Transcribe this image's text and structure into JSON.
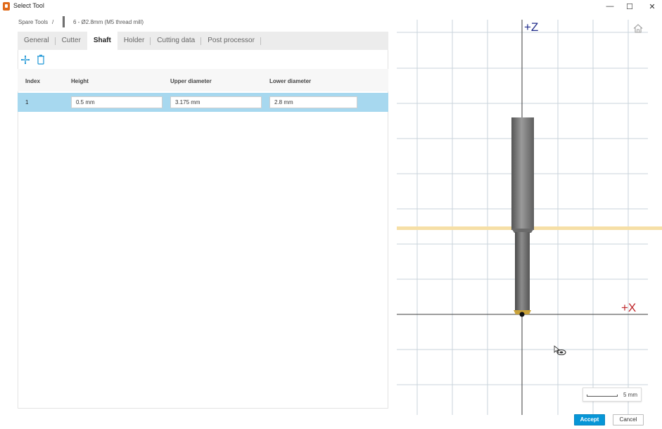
{
  "window": {
    "title": "Select Tool",
    "controls": {
      "minimize": "—",
      "maximize": "☐",
      "close": "✕"
    }
  },
  "breadcrumb": {
    "library": "Spare Tools",
    "separator": "/",
    "tool": "6 - Ø2.8mm (M5 thread mill)"
  },
  "tabs": [
    "General",
    "Cutter",
    "Shaft",
    "Holder",
    "Cutting data",
    "Post processor"
  ],
  "active_tab": "Shaft",
  "toolbar": {
    "add_icon": "plus-icon",
    "delete_icon": "trash-icon"
  },
  "table": {
    "columns": [
      "Index",
      "Height",
      "Upper diameter",
      "Lower diameter"
    ],
    "rows": [
      {
        "index": "1",
        "height": "0.5 mm",
        "upper_diameter": "3.175 mm",
        "lower_diameter": "2.8 mm"
      }
    ]
  },
  "viewport": {
    "axis_z_label": "+Z",
    "axis_x_label": "+X",
    "scale_label": "5 mm",
    "colors": {
      "grid": "#c8d3db",
      "axis_z": "#1f2b8a",
      "axis_x": "#c0282c",
      "gauge_line": "#f6dfa6",
      "tool_body": "#7a7a7a"
    }
  },
  "buttons": {
    "accept": "Accept",
    "cancel": "Cancel"
  },
  "colors": {
    "accent": "#0696d7",
    "selected_row": "#a7d8ef",
    "app_icon": "#e06a1a"
  }
}
